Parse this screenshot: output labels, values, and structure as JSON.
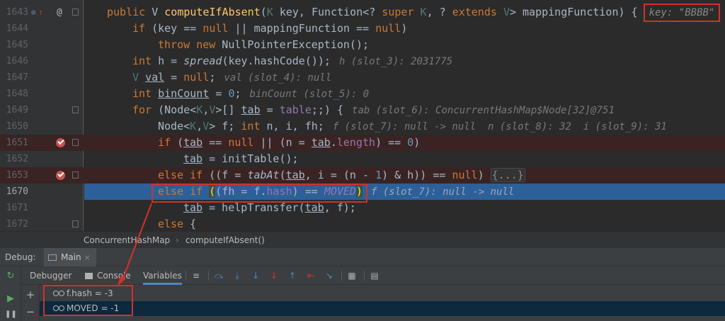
{
  "editor": {
    "lines": [
      {
        "num": "1643"
      },
      {
        "num": "1644"
      },
      {
        "num": "1645"
      },
      {
        "num": "1646"
      },
      {
        "num": "1647"
      },
      {
        "num": "1648"
      },
      {
        "num": "1649"
      },
      {
        "num": "1650"
      },
      {
        "num": "1651"
      },
      {
        "num": "1652"
      },
      {
        "num": "1653"
      },
      {
        "num": "1670"
      },
      {
        "num": "1671"
      },
      {
        "num": "1672"
      }
    ],
    "key_hint": "key: \"BBBB\"",
    "code": {
      "l0": {
        "a": "public",
        "b": " V ",
        "c": "computeIfAbsent",
        "d": "(",
        "e": "K",
        "f": " key, Function<? ",
        "g": "super",
        "h": " ",
        "i": "K",
        "j": ", ? ",
        "k": "extends",
        "l": " ",
        "m": "V",
        "n": "> mappingFunction) {"
      },
      "l1": {
        "a": "if",
        "b": " (key == ",
        "c": "null",
        "d": " || mappingFunction == ",
        "e": "null",
        "f": ")"
      },
      "l2": {
        "a": "throw",
        "b": " ",
        "c": "new",
        "d": " NullPointerException();"
      },
      "l3": {
        "a": "int",
        "b": " h = ",
        "c": "spread",
        "d": "(key.hashCode());",
        "hint": "h (slot_3): 2031775"
      },
      "l4": {
        "a": "V",
        "b": " ",
        "c": "val",
        "d": " = ",
        "e": "null",
        "f": ";",
        "hint": "val (slot_4): null"
      },
      "l5": {
        "a": "int",
        "b": " ",
        "c": "binCount",
        "d": " = ",
        "e": "0",
        "f": ";",
        "hint": "binCount (slot_5): 0"
      },
      "l6": {
        "a": "for",
        "b": " (Node<",
        "c": "K",
        "d": ",",
        "e": "V",
        "f": ">[] ",
        "g": "tab",
        "h": " = ",
        "i": "table",
        "j": ";;) {",
        "hint": "tab (slot_6): ConcurrentHashMap$Node[32]@751"
      },
      "l7": {
        "a": "Node<",
        "b": "K",
        "c": ",",
        "d": "V",
        "e": "> f; ",
        "f": "int",
        "g": " n, i, fh;",
        "hint": "f (slot_7): null -> null  n (slot_8): 32  i (slot_9): 31"
      },
      "l8": {
        "a": "if",
        "b": " (",
        "c": "tab",
        "d": " == ",
        "e": "null",
        "f": " || (n = ",
        "g": "tab",
        "h": ".",
        "i": "length",
        "j": ") == ",
        "k": "0",
        "l": ")"
      },
      "l9": {
        "a": "tab",
        "b": " = initTable();"
      },
      "l10": {
        "a": "else if",
        "b": " ((f = ",
        "c": "tabAt",
        "d": "(",
        "e": "tab",
        "f": ", i = (n - ",
        "g": "1",
        "h": ") & h)) == ",
        "i": "null",
        "j": ") ",
        "k": "{...}"
      },
      "l11": {
        "a": "else if",
        "b": " ",
        "c": "(",
        "d": "(fh = f.",
        "e": "hash",
        "f": ") == ",
        "g": "MOVED",
        "h": ")",
        "hint": "f (slot_7): null -> null"
      },
      "l12": {
        "a": "tab",
        "b": " = helpTransfer(",
        "c": "tab",
        "d": ", f);"
      },
      "l13": {
        "a": "else",
        "b": " {"
      }
    }
  },
  "breadcrumb": {
    "class": "ConcurrentHashMap",
    "sep": "›",
    "method": "computeIfAbsent()"
  },
  "debug": {
    "title": "Debug:",
    "session_tab": "Main",
    "tabs": {
      "debugger": "Debugger",
      "console": "Console",
      "variables": "Variables"
    },
    "watches": [
      {
        "name": "f.hash",
        "value": " = -3"
      },
      {
        "name": "MOVED",
        "value": " = -1"
      }
    ]
  },
  "colors": {
    "accent": "#2d6099",
    "annotation": "#d4302a",
    "keyword": "#cc7832",
    "constant": "#9876aa"
  }
}
